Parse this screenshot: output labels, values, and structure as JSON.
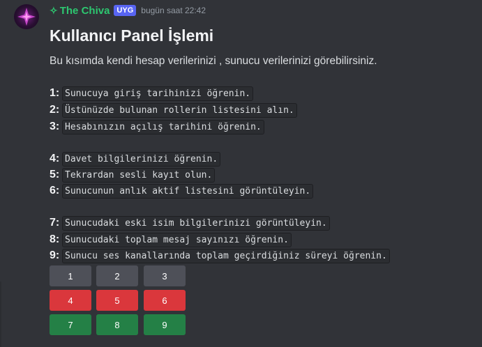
{
  "message": {
    "author": {
      "sparkle_glyph": "✧",
      "name": "The Chiva",
      "name_color": "#2dc770",
      "tag": "UYG",
      "tag_color": "#5865f2"
    },
    "timestamp": "bugün saat 22:42",
    "avatar_icon": "purple-star-avatar"
  },
  "embed": {
    "title": "Kullanıcı Panel İşlemi",
    "description": "Bu kısımda kendi hesap verilerinizi , sunucu verilerinizi görebilirsiniz.",
    "items": [
      {
        "num": "1:",
        "text": "Sunucuya giriş tarihinizi öğrenin."
      },
      {
        "num": "2:",
        "text": "Üstünüzde bulunan rollerin listesini alın."
      },
      {
        "num": "3:",
        "text": "Hesabınızın açılış tarihini öğrenin."
      },
      {
        "num": "4:",
        "text": "Davet bilgilerinizi öğrenin."
      },
      {
        "num": "5:",
        "text": "Tekrardan sesli kayıt olun."
      },
      {
        "num": "6:",
        "text": "Sunucunun anlık aktif listesini görüntüleyin."
      },
      {
        "num": "7:",
        "text": "Sunucudaki eski isim bilgilerinizi görüntüleyin."
      },
      {
        "num": "8:",
        "text": "Sunucudaki toplam mesaj sayınızı öğrenin."
      },
      {
        "num": "9:",
        "text": "Sunucu ses kanallarında toplam geçirdiğiniz süreyi öğrenin."
      }
    ]
  },
  "buttons": [
    {
      "label": "1",
      "style": "gray",
      "color": "#4e5058"
    },
    {
      "label": "2",
      "style": "gray",
      "color": "#4e5058"
    },
    {
      "label": "3",
      "style": "gray",
      "color": "#4e5058"
    },
    {
      "label": "4",
      "style": "red",
      "color": "#da373c"
    },
    {
      "label": "5",
      "style": "red",
      "color": "#da373c"
    },
    {
      "label": "6",
      "style": "red",
      "color": "#da373c"
    },
    {
      "label": "7",
      "style": "green",
      "color": "#248046"
    },
    {
      "label": "8",
      "style": "green",
      "color": "#248046"
    },
    {
      "label": "9",
      "style": "green",
      "color": "#248046"
    }
  ]
}
